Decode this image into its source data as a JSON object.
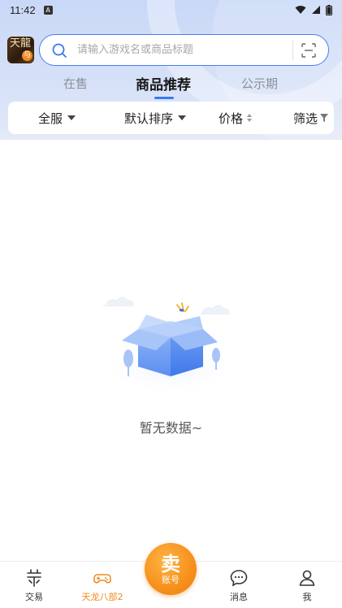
{
  "status_bar": {
    "time": "11:42",
    "notification_glyph": "A"
  },
  "header": {
    "game_avatar": {
      "glyph": "天龍",
      "badge": "与"
    },
    "search": {
      "placeholder": "请输入游戏名或商品标题"
    }
  },
  "tabs": [
    {
      "label": "在售",
      "active": false
    },
    {
      "label": "商品推荐",
      "active": true
    },
    {
      "label": "公示期",
      "active": false
    }
  ],
  "filters": {
    "server": "全服",
    "sort": "默认排序",
    "price": "价格",
    "filter": "筛选"
  },
  "empty_state": {
    "message": "暂无数据~"
  },
  "bottom_nav": {
    "items": [
      {
        "label": "交易",
        "icon": "trade-icon",
        "active": false
      },
      {
        "label": "天龙八部2",
        "icon": "gamepad-icon",
        "active": true
      },
      {
        "label": "消息",
        "icon": "chat-icon",
        "active": false
      },
      {
        "label": "我",
        "icon": "user-icon",
        "active": false
      }
    ],
    "sell_button": {
      "title": "卖",
      "subtitle": "账号"
    }
  },
  "colors": {
    "accent_blue": "#3a78f2",
    "active_orange": "#f08a24",
    "header_bg": "#d6e1f8"
  }
}
